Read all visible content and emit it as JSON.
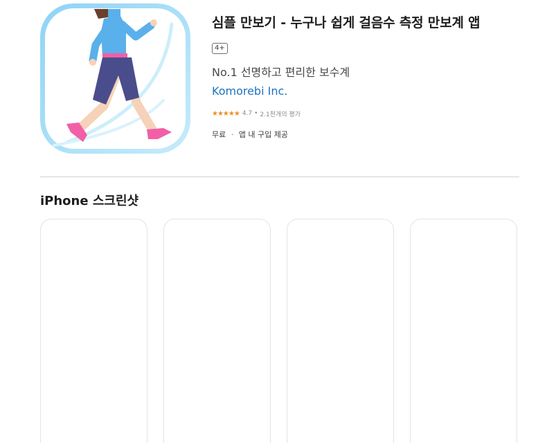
{
  "app": {
    "title": "심플 만보기 - 누구나 쉽게 걸음수 측정 만보계 앱",
    "age_rating": "4+",
    "subtitle": "No.1 선명하고 편리한 보수계",
    "developer": "Komorebi Inc.",
    "rating": {
      "stars": "★★★★★",
      "value": "4.7",
      "separator": "•",
      "count": "2.1천개의 평가"
    },
    "price": "무료",
    "price_separator": "·",
    "iap": "앱 내 구입 제공",
    "icon": "walking-woman-icon"
  },
  "screenshots": {
    "heading": "iPhone 스크린샷",
    "count": 4
  },
  "colors": {
    "developer_link": "#1b72c2",
    "star": "#ee8f26",
    "divider": "#d2d2d7",
    "icon_border": "#9fd8f3",
    "jacket": "#5ab0ea",
    "shorts": "#4a4d8c",
    "shoes": "#f25fa6"
  }
}
